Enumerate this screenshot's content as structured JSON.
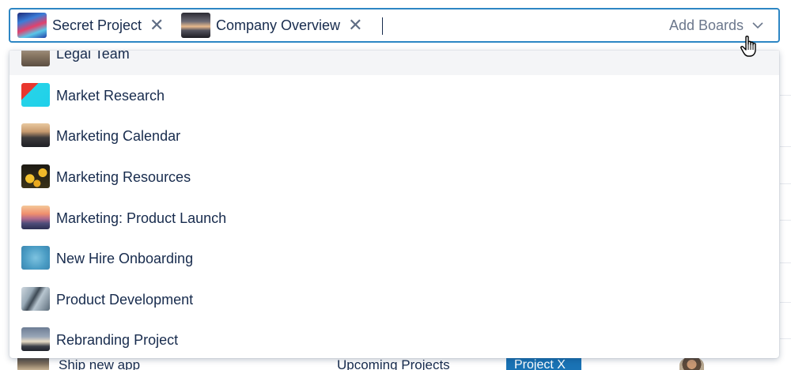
{
  "tag_input": {
    "chips": [
      {
        "label": "Secret Project",
        "remove": "✕"
      },
      {
        "label": "Company Overview",
        "remove": "✕"
      }
    ],
    "placeholder": "Add Boards",
    "chevron_icon": "chevron-down-icon"
  },
  "dropdown": {
    "options": [
      {
        "label": "Legal Team",
        "highlighted": true
      },
      {
        "label": "Market Research",
        "highlighted": false
      },
      {
        "label": "Marketing Calendar",
        "highlighted": false
      },
      {
        "label": "Marketing Resources",
        "highlighted": false
      },
      {
        "label": "Marketing: Product Launch",
        "highlighted": false
      },
      {
        "label": "New Hire Onboarding",
        "highlighted": false
      },
      {
        "label": "Product Development",
        "highlighted": false
      },
      {
        "label": "Rebranding Project",
        "highlighted": false
      }
    ]
  },
  "background_row": {
    "name": "Ship new app",
    "list": "Upcoming Projects",
    "tag": "Project X"
  },
  "colors": {
    "focus_border": "#2d86c4",
    "text": "#172b4d",
    "muted": "#6b778c",
    "highlight_row": "#f4f5f7",
    "badge": "#1a73b5"
  },
  "cursor": "hand-pointer-icon"
}
